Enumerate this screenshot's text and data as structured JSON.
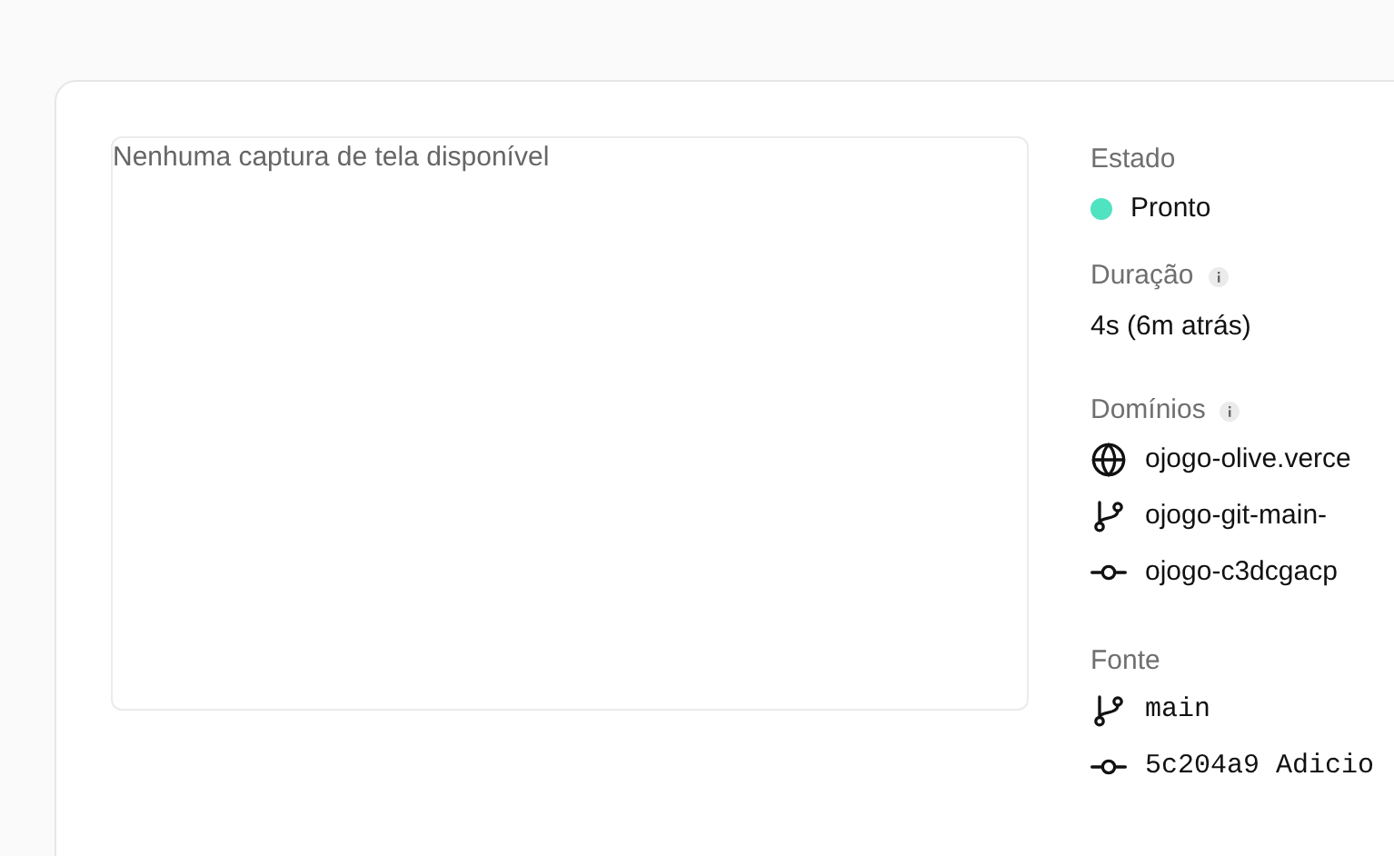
{
  "preview": {
    "placeholder_text": "Nenhuma captura de tela disponível"
  },
  "status": {
    "label": "Estado",
    "value": "Pronto",
    "color": "#50e3c2"
  },
  "duration": {
    "label": "Duração",
    "info": true,
    "value": "4s (6m atrás)"
  },
  "domains": {
    "label": "Domínios",
    "info": true,
    "items": [
      {
        "kind": "globe",
        "text": "ojogo-olive.verce"
      },
      {
        "kind": "branch",
        "text": "ojogo-git-main-"
      },
      {
        "kind": "commit",
        "text": "ojogo-c3dcgacp"
      }
    ]
  },
  "source": {
    "label": "Fonte",
    "items": [
      {
        "kind": "branch",
        "text": "main"
      },
      {
        "kind": "commit",
        "text": "5c204a9 Adicio"
      }
    ]
  }
}
